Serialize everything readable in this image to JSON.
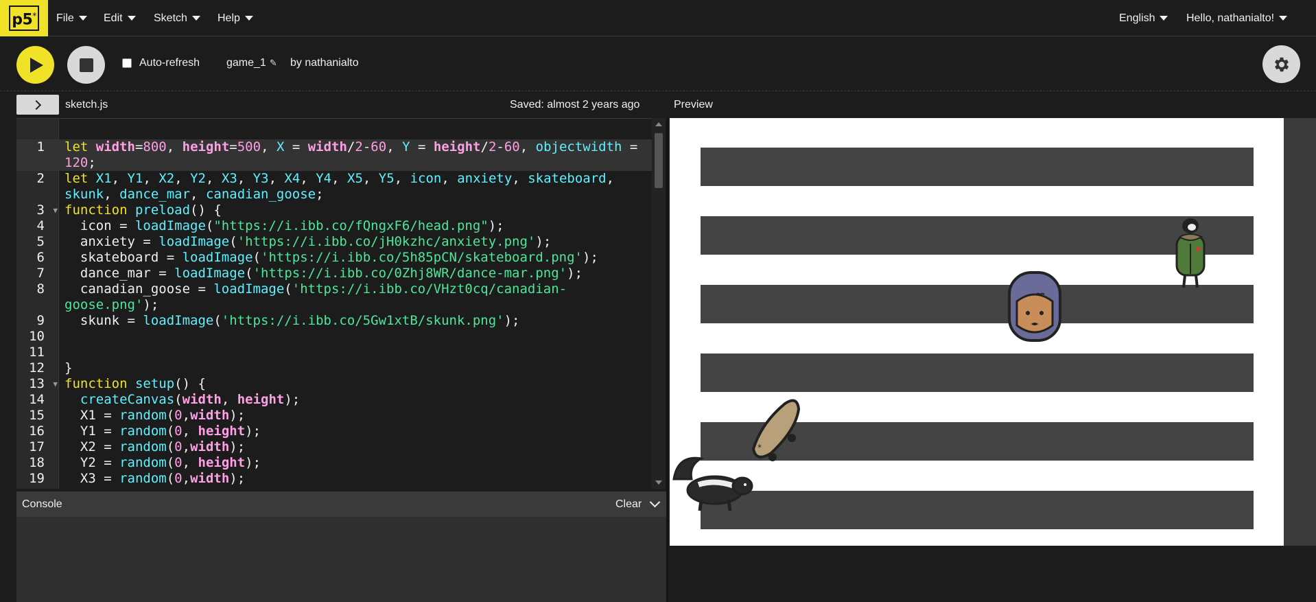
{
  "nav": {
    "logo": "p5",
    "logo_sup": "*",
    "menus": [
      "File",
      "Edit",
      "Sketch",
      "Help"
    ],
    "language": "English",
    "greeting": "Hello, nathanialto!"
  },
  "toolbar": {
    "auto_refresh_label": "Auto-refresh",
    "auto_refresh_checked": false,
    "sketch_name": "game_1",
    "by_author": "by nathanialto"
  },
  "editor": {
    "file_name": "sketch.js",
    "saved_status": "Saved: almost 2 years ago",
    "preview_label": "Preview",
    "lines": [
      {
        "n": "1",
        "active": true,
        "tokens": [
          [
            "k",
            "let "
          ],
          [
            "v",
            "width"
          ],
          [
            "t",
            "="
          ],
          [
            "n",
            "800"
          ],
          [
            "t",
            ", "
          ],
          [
            "v",
            "height"
          ],
          [
            "t",
            "="
          ],
          [
            "n",
            "500"
          ],
          [
            "t",
            ", "
          ],
          [
            "c",
            "X"
          ],
          [
            "t",
            " = "
          ],
          [
            "v",
            "width"
          ],
          [
            "t",
            "/"
          ],
          [
            "n",
            "2"
          ],
          [
            "t",
            "-"
          ],
          [
            "n",
            "60"
          ],
          [
            "t",
            ", "
          ],
          [
            "c",
            "Y"
          ],
          [
            "t",
            " = "
          ],
          [
            "v",
            "height"
          ],
          [
            "t",
            "/"
          ],
          [
            "n",
            "2"
          ],
          [
            "t",
            "-"
          ],
          [
            "n",
            "60"
          ],
          [
            "t",
            ", "
          ],
          [
            "c",
            "objectwidth"
          ],
          [
            "t",
            " ="
          ]
        ]
      },
      {
        "n": "",
        "active": true,
        "tokens": [
          [
            "n",
            "120"
          ],
          [
            "t",
            ";"
          ]
        ]
      },
      {
        "n": "2",
        "tokens": [
          [
            "k",
            "let "
          ],
          [
            "c",
            "X1"
          ],
          [
            "t",
            ", "
          ],
          [
            "c",
            "Y1"
          ],
          [
            "t",
            ", "
          ],
          [
            "c",
            "X2"
          ],
          [
            "t",
            ", "
          ],
          [
            "c",
            "Y2"
          ],
          [
            "t",
            ", "
          ],
          [
            "c",
            "X3"
          ],
          [
            "t",
            ", "
          ],
          [
            "c",
            "Y3"
          ],
          [
            "t",
            ", "
          ],
          [
            "c",
            "X4"
          ],
          [
            "t",
            ", "
          ],
          [
            "c",
            "Y4"
          ],
          [
            "t",
            ", "
          ],
          [
            "c",
            "X5"
          ],
          [
            "t",
            ", "
          ],
          [
            "c",
            "Y5"
          ],
          [
            "t",
            ", "
          ],
          [
            "c",
            "icon"
          ],
          [
            "t",
            ", "
          ],
          [
            "c",
            "anxiety"
          ],
          [
            "t",
            ", "
          ],
          [
            "c",
            "skateboard"
          ],
          [
            "t",
            ","
          ]
        ]
      },
      {
        "n": "",
        "tokens": [
          [
            "c",
            "skunk"
          ],
          [
            "t",
            ", "
          ],
          [
            "c",
            "dance_mar"
          ],
          [
            "t",
            ", "
          ],
          [
            "c",
            "canadian_goose"
          ],
          [
            "t",
            ";"
          ]
        ]
      },
      {
        "n": "3",
        "fold": true,
        "tokens": [
          [
            "k",
            "function "
          ],
          [
            "f",
            "preload"
          ],
          [
            "t",
            "() {"
          ]
        ]
      },
      {
        "n": "4",
        "tokens": [
          [
            "t",
            "  icon = "
          ],
          [
            "f",
            "loadImage"
          ],
          [
            "t",
            "("
          ],
          [
            "s",
            "\"https://i.ibb.co/fQngxF6/head.png\""
          ],
          [
            "t",
            ");"
          ]
        ]
      },
      {
        "n": "5",
        "tokens": [
          [
            "t",
            "  anxiety = "
          ],
          [
            "f",
            "loadImage"
          ],
          [
            "t",
            "("
          ],
          [
            "s",
            "'https://i.ibb.co/jH0kzhc/anxiety.png'"
          ],
          [
            "t",
            ");"
          ]
        ]
      },
      {
        "n": "6",
        "tokens": [
          [
            "t",
            "  skateboard = "
          ],
          [
            "f",
            "loadImage"
          ],
          [
            "t",
            "("
          ],
          [
            "s",
            "'https://i.ibb.co/5h85pCN/skateboard.png'"
          ],
          [
            "t",
            ");"
          ]
        ]
      },
      {
        "n": "7",
        "tokens": [
          [
            "t",
            "  dance_mar = "
          ],
          [
            "f",
            "loadImage"
          ],
          [
            "t",
            "("
          ],
          [
            "s",
            "'https://i.ibb.co/0Zhj8WR/dance-mar.png'"
          ],
          [
            "t",
            ");"
          ]
        ]
      },
      {
        "n": "8",
        "tokens": [
          [
            "t",
            "  canadian_goose = "
          ],
          [
            "f",
            "loadImage"
          ],
          [
            "t",
            "("
          ],
          [
            "s",
            "'https://i.ibb.co/VHzt0cq/canadian-"
          ]
        ]
      },
      {
        "n": "",
        "tokens": [
          [
            "s",
            "goose.png'"
          ],
          [
            "t",
            ");"
          ]
        ]
      },
      {
        "n": "9",
        "tokens": [
          [
            "t",
            "  skunk = "
          ],
          [
            "f",
            "loadImage"
          ],
          [
            "t",
            "("
          ],
          [
            "s",
            "'https://i.ibb.co/5Gw1xtB/skunk.png'"
          ],
          [
            "t",
            ");"
          ]
        ]
      },
      {
        "n": "10",
        "tokens": [
          [
            "t",
            " "
          ]
        ]
      },
      {
        "n": "11",
        "tokens": [
          [
            "t",
            " "
          ]
        ]
      },
      {
        "n": "12",
        "tokens": [
          [
            "t",
            "}"
          ]
        ]
      },
      {
        "n": "13",
        "fold": true,
        "tokens": [
          [
            "k",
            "function "
          ],
          [
            "f",
            "setup"
          ],
          [
            "t",
            "() {"
          ]
        ]
      },
      {
        "n": "14",
        "tokens": [
          [
            "t",
            "  "
          ],
          [
            "f",
            "createCanvas"
          ],
          [
            "t",
            "("
          ],
          [
            "v",
            "width"
          ],
          [
            "t",
            ", "
          ],
          [
            "v",
            "height"
          ],
          [
            "t",
            ");"
          ]
        ]
      },
      {
        "n": "15",
        "tokens": [
          [
            "t",
            "  X1 = "
          ],
          [
            "f",
            "random"
          ],
          [
            "t",
            "("
          ],
          [
            "n",
            "0"
          ],
          [
            "t",
            ","
          ],
          [
            "v",
            "width"
          ],
          [
            "t",
            ");"
          ]
        ]
      },
      {
        "n": "16",
        "tokens": [
          [
            "t",
            "  Y1 = "
          ],
          [
            "f",
            "random"
          ],
          [
            "t",
            "("
          ],
          [
            "n",
            "0"
          ],
          [
            "t",
            ", "
          ],
          [
            "v",
            "height"
          ],
          [
            "t",
            ");"
          ]
        ]
      },
      {
        "n": "17",
        "tokens": [
          [
            "t",
            "  X2 = "
          ],
          [
            "f",
            "random"
          ],
          [
            "t",
            "("
          ],
          [
            "n",
            "0"
          ],
          [
            "t",
            ","
          ],
          [
            "v",
            "width"
          ],
          [
            "t",
            ");"
          ]
        ]
      },
      {
        "n": "18",
        "tokens": [
          [
            "t",
            "  Y2 = "
          ],
          [
            "f",
            "random"
          ],
          [
            "t",
            "("
          ],
          [
            "n",
            "0"
          ],
          [
            "t",
            ", "
          ],
          [
            "v",
            "height"
          ],
          [
            "t",
            ");"
          ]
        ]
      },
      {
        "n": "19",
        "tokens": [
          [
            "t",
            "  X3 = "
          ],
          [
            "f",
            "random"
          ],
          [
            "t",
            "("
          ],
          [
            "n",
            "0"
          ],
          [
            "t",
            ","
          ],
          [
            "v",
            "width"
          ],
          [
            "t",
            ");"
          ]
        ]
      }
    ]
  },
  "console": {
    "title": "Console",
    "clear_label": "Clear"
  },
  "colors": {
    "accent": "#f0e227",
    "background": "#1c1c1c",
    "stripe": "#444444"
  }
}
